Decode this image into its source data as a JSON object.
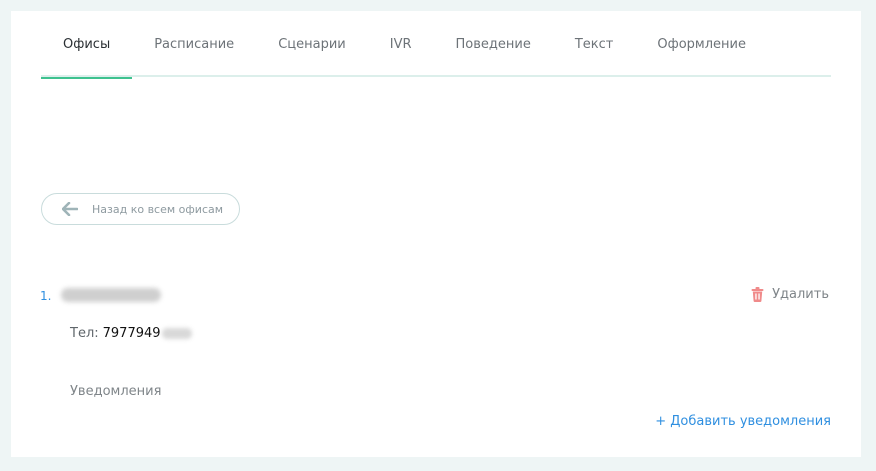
{
  "tabs": [
    {
      "label": "Офисы",
      "active": true
    },
    {
      "label": "Расписание",
      "active": false
    },
    {
      "label": "Сценарии",
      "active": false
    },
    {
      "label": "IVR",
      "active": false
    },
    {
      "label": "Поведение",
      "active": false
    },
    {
      "label": "Текст",
      "active": false
    },
    {
      "label": "Оформление",
      "active": false
    }
  ],
  "back_button": {
    "label": "Назад ко всем офисам",
    "icon": "arrow-left-icon"
  },
  "office": {
    "number": "1.",
    "delete_label": "Удалить",
    "delete_icon": "trash-icon",
    "phone_label": "Тел:",
    "phone_value": "7977949"
  },
  "notifications": {
    "label": "Уведомления",
    "add_label": "+ Добавить уведомления"
  },
  "colors": {
    "accent": "#3ec28f",
    "link": "#2f8fe0",
    "delete_icon": "#f08a8a",
    "background": "#eef5f5"
  }
}
